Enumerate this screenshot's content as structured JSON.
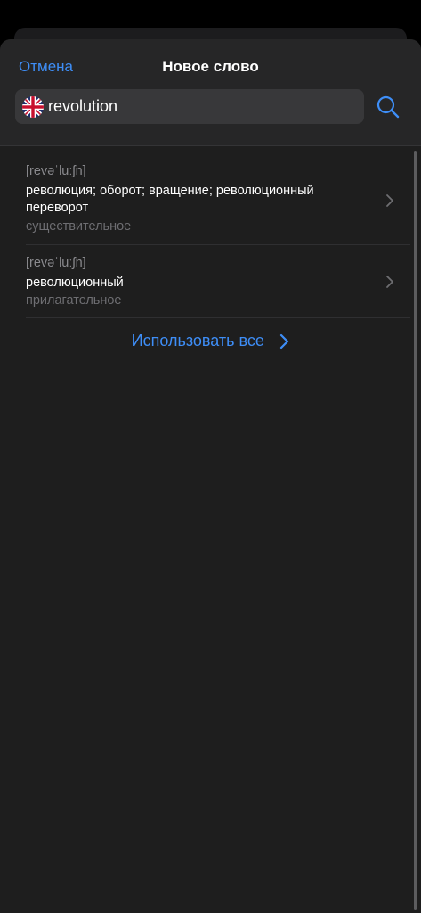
{
  "header": {
    "cancel_label": "Отмена",
    "title": "Новое слово"
  },
  "search": {
    "value": "revolution",
    "language_flag": "uk-flag-icon",
    "action_icon": "search-icon"
  },
  "entries": [
    {
      "phonetic": "[revəˈluːʃn]",
      "translation": "революция; оборот; вращение; революционный переворот",
      "part_of_speech": "существительное"
    },
    {
      "phonetic": "[revəˈluːʃn]",
      "translation": "революционный",
      "part_of_speech": "прилагательное"
    }
  ],
  "use_all_label": "Использовать все",
  "colors": {
    "accent": "#3e8ef7",
    "background": "#1e1e1e",
    "header": "#262627",
    "search_field": "#38383a",
    "secondary_text": "#8a8a8e"
  }
}
